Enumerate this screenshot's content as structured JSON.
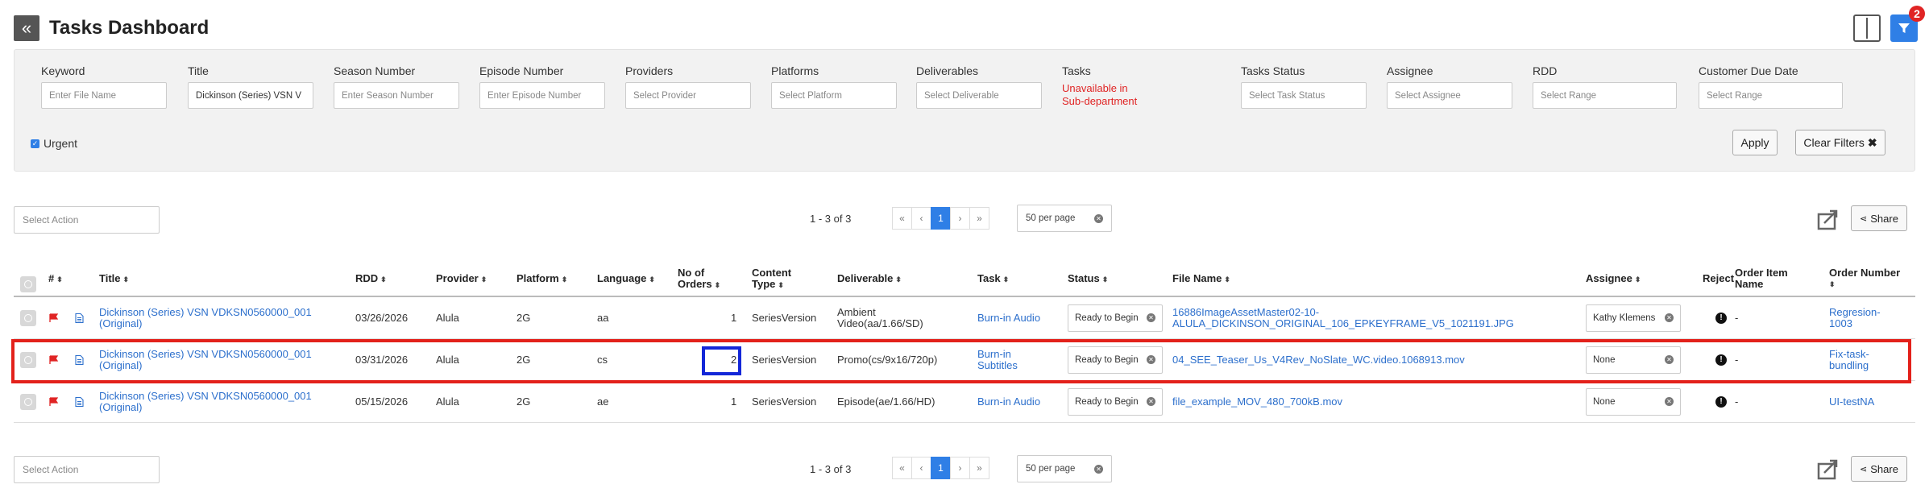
{
  "header": {
    "title": "Tasks Dashboard",
    "filter_badge": "2"
  },
  "filters": {
    "keyword": {
      "label": "Keyword",
      "placeholder": "Enter File Name"
    },
    "title": {
      "label": "Title",
      "value": "Dickinson (Series) VSN V"
    },
    "season": {
      "label": "Season Number",
      "placeholder": "Enter Season Number"
    },
    "episode": {
      "label": "Episode Number",
      "placeholder": "Enter Episode Number"
    },
    "providers": {
      "label": "Providers",
      "placeholder": "Select Provider"
    },
    "platforms": {
      "label": "Platforms",
      "placeholder": "Select Platform"
    },
    "deliverables": {
      "label": "Deliverables",
      "placeholder": "Select Deliverable"
    },
    "tasks": {
      "label": "Tasks",
      "unavailable_line1": "Unavailable in",
      "unavailable_line2": "Sub-department"
    },
    "tasks_status": {
      "label": "Tasks Status",
      "placeholder": "Select Task Status"
    },
    "assignee": {
      "label": "Assignee",
      "placeholder": "Select Assignee"
    },
    "rdd": {
      "label": "RDD",
      "placeholder": "Select Range"
    },
    "customer_due": {
      "label": "Customer Due Date",
      "placeholder": "Select Range"
    },
    "urgent_label": "Urgent",
    "apply_label": "Apply",
    "clear_label": "Clear Filters"
  },
  "toolbar": {
    "select_action_placeholder": "Select Action",
    "pager_info": "1 - 3 of 3",
    "pages": [
      "«",
      "‹",
      "1",
      "›",
      "»"
    ],
    "per_page": "50 per page",
    "share_label": "Share"
  },
  "table": {
    "headers": {
      "num": "#",
      "title": "Title",
      "rdd": "RDD",
      "provider": "Provider",
      "platform": "Platform",
      "language": "Language",
      "orders_1": "No of",
      "orders_2": "Orders",
      "content_type_1": "Content",
      "content_type_2": "Type",
      "deliverable": "Deliverable",
      "task": "Task",
      "status": "Status",
      "file_name": "File Name",
      "assignee": "Assignee",
      "reject": "Reject",
      "order_item_1": "Order Item",
      "order_item_2": "Name",
      "order_number": "Order Number"
    },
    "rows": [
      {
        "title_1": "Dickinson (Series) VSN VDKSN0560000_001",
        "title_2": "(Original)",
        "rdd": "03/26/2026",
        "provider": "Alula",
        "platform": "2G",
        "language": "aa",
        "orders": "1",
        "content_type": "SeriesVersion",
        "deliverable_1": "Ambient",
        "deliverable_2": "Video(aa/1.66/SD)",
        "task_1": "Burn-in Audio",
        "task_2": "",
        "status": "Ready to Begin",
        "file_1": "16886ImageAssetMaster02-10-",
        "file_2": "ALULA_DICKINSON_ORIGINAL_106_EPKEYFRAME_V5_1021191.JPG",
        "assignee": "Kathy Klemens",
        "order_item": "-",
        "order_1": "Regresion-",
        "order_2": "1003"
      },
      {
        "title_1": "Dickinson (Series) VSN VDKSN0560000_001",
        "title_2": "(Original)",
        "rdd": "03/31/2026",
        "provider": "Alula",
        "platform": "2G",
        "language": "cs",
        "orders": "2",
        "content_type": "SeriesVersion",
        "deliverable_1": "Promo(cs/9x16/720p)",
        "deliverable_2": "",
        "task_1": "Burn-in",
        "task_2": "Subtitles",
        "status": "Ready to Begin",
        "file_1": "04_SEE_Teaser_Us_V4Rev_NoSlate_WC.video.1068913.mov",
        "file_2": "",
        "assignee": "None",
        "order_item": "-",
        "order_1": "Fix-task-",
        "order_2": "bundling"
      },
      {
        "title_1": "Dickinson (Series) VSN VDKSN0560000_001",
        "title_2": "(Original)",
        "rdd": "05/15/2026",
        "provider": "Alula",
        "platform": "2G",
        "language": "ae",
        "orders": "1",
        "content_type": "SeriesVersion",
        "deliverable_1": "Episode(ae/1.66/HD)",
        "deliverable_2": "",
        "task_1": "Burn-in Audio",
        "task_2": "",
        "status": "Ready to Begin",
        "file_1": "file_example_MOV_480_700kB.mov",
        "file_2": "",
        "assignee": "None",
        "order_item": "-",
        "order_1": "UI-testNA",
        "order_2": ""
      }
    ]
  },
  "colors": {
    "accent": "#2f7fe6",
    "danger": "#e02424",
    "link": "#2c6fcc",
    "highlight_red": "#e3211b",
    "highlight_blue": "#1327d8"
  }
}
